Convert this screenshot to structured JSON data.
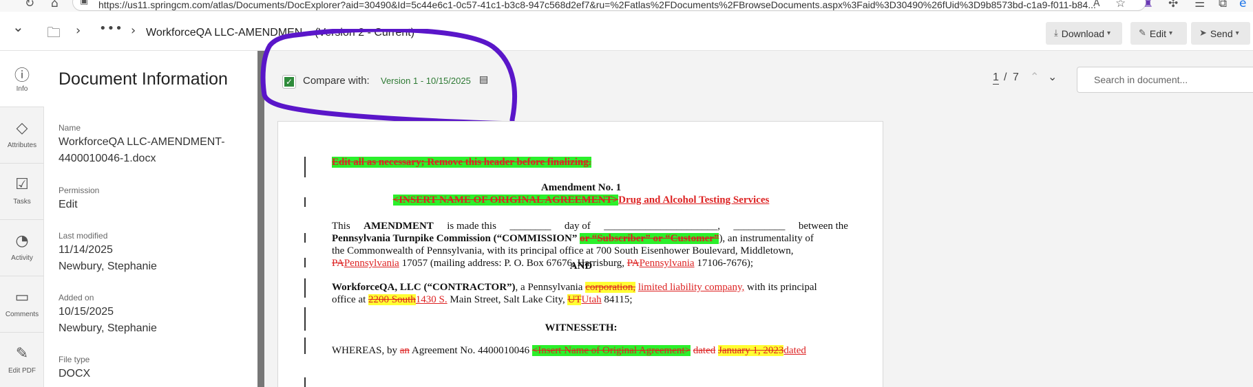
{
  "browser": {
    "url": "https://us11.springcm.com/atlas/Documents/DocExplorer?aid=30490&Id=5c44e6c1-0c57-41c1-b3c8-947c568d2ef7&ru=%2Fatlas%2FDocuments%2FBrowseDocuments.aspx%3Faid%3D30490%26fUid%3D9b8573bd-c1a9-f011-b84..."
  },
  "header": {
    "title": "WorkforceQA LLC-AMENDMEN... (Version 2 - Current)",
    "download_label": "Download",
    "edit_label": "Edit",
    "send_label": "Send"
  },
  "rail": {
    "info": "Info",
    "attributes": "Attributes",
    "tasks": "Tasks",
    "activity": "Activity",
    "comments": "Comments",
    "editpdf": "Edit PDF"
  },
  "info_panel": {
    "title": "Document Information",
    "name_label": "Name",
    "name_line1": "WorkforceQA LLC-AMENDMENT-",
    "name_line2": "4400010046-1.docx",
    "permission_label": "Permission",
    "permission_value": "Edit",
    "last_modified_label": "Last modified",
    "last_modified_date": "11/14/2025",
    "last_modified_by": "Newbury, Stephanie",
    "added_label": "Added on",
    "added_date": "10/15/2025",
    "added_by": "Newbury, Stephanie",
    "filetype_label": "File type",
    "filetype_value": "DOCX"
  },
  "compare": {
    "checked": true,
    "label": "Compare with:",
    "version": "Version 1 - 10/15/2025",
    "annotation_color": "#5a16c9"
  },
  "pager": {
    "current": "1",
    "separator": "/",
    "total": "7"
  },
  "search": {
    "placeholder": "Search in document..."
  },
  "document": {
    "header_note": "Edit all as necessary; Remove this header before finalizing.",
    "amendment_title": "Amendment No. 1",
    "insert_name_deleted": "<INSERT NAME OF ORIGINAL AGREEMENT>",
    "insert_name_new": "Drug and Alcohol Testing Services",
    "p1_w1": "This",
    "p1_w2": "AMENDMENT",
    "p1_w3": "is made this",
    "p1_w4": "________",
    "p1_w5": "day of",
    "p1_w6": "______________________,",
    "p1_w7": "__________",
    "p1_w8": "between the",
    "p1_l2a": "Pennsylvania Turnpike Commission (“COMMISSION”",
    "p1_l2del": "or “Subscriber” or “Customer”",
    "p1_l2b": "), an instrumentality of",
    "p1_l3": "the Commonwealth of Pennsylvania, with its principal office at 700 South Eisenhower Boulevard, Middletown,",
    "pa_del": "PA",
    "pa_ins": "Pennsylvania",
    "p1_l4b": "17057 (mailing address: P. O. Box 67676, Harrisburg,",
    "p1_l4c": "17106-7676);",
    "and": "AND",
    "p2_a": "WorkforceQA, LLC (“CONTRACTOR”)",
    "p2_b": ", a Pennsylvania",
    "p2_del": "corporation,",
    "p2_ins": "limited liability company,",
    "p2_c": "with its principal",
    "p2_l2a": "office at",
    "p2_addr_del": "2200 South",
    "p2_addr_ins": "1430 S.",
    "p2_l2b": "Main Street, Salt Lake City,",
    "ut_del": "UT",
    "ut_ins": "Utah",
    "p2_zip": "84115;",
    "witnesseth": "WITNESSETH:",
    "p3_a": "WHEREAS, by",
    "p3_del": "an",
    "p3_b": "Agreement No. 4400010046",
    "p3_g": "<Insert Name of Original Agreement>",
    "p3_dated_del": "dated",
    "p3_date_del": "January 1, 2023",
    "p3_dated_ins": "dated"
  }
}
